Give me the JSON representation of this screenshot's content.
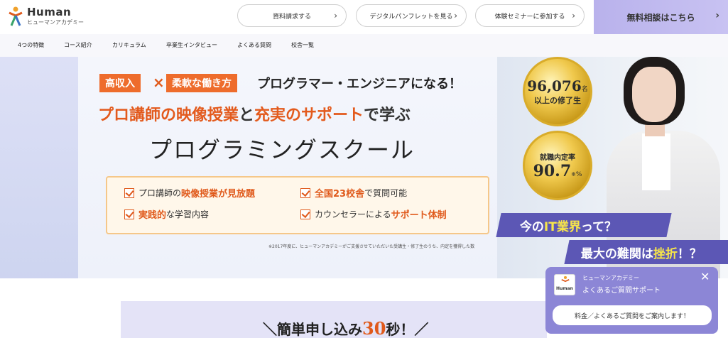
{
  "header": {
    "logo_word": "Human",
    "logo_sub": "ヒューマンアカデミー",
    "links": [
      {
        "label": "資料請求する"
      },
      {
        "label": "デジタルパンフレットを見る"
      },
      {
        "label": "体験セミナーに参加する"
      }
    ],
    "cta_label": "無料相談はこちら",
    "chevron": "›"
  },
  "nav": {
    "items": [
      "4つの特徴",
      "コース紹介",
      "カリキュラム",
      "卒業生インタビュー",
      "よくある質問",
      "校舎一覧"
    ]
  },
  "hero": {
    "tag1": "高収入",
    "times": "×",
    "tag2": "柔軟な働き方",
    "head1": "プログラマー・エンジニアになる！",
    "head2_part1": "プロ講師の映像授業",
    "head2_part2": "と",
    "head2_part3": "充実のサポート",
    "head2_part4": "で学ぶ",
    "head3": "プログラミングスクール",
    "features": [
      {
        "pre": "プロ講師の",
        "hl": "映像授業が見放題",
        "post": ""
      },
      {
        "pre": "",
        "hl": "全国23校舎",
        "post": "で質問可能"
      },
      {
        "pre": "",
        "hl": "実践的",
        "post": "な学習内容"
      },
      {
        "pre": "カウンセラーによる",
        "hl": "サポート体制",
        "post": ""
      }
    ],
    "footnote": "※2017年度に、ヒューマンアカデミーがご支援させていただいた受講生・修了生のうち、内定を獲得した数",
    "medal1": {
      "num": "96,076",
      "unit": "名",
      "sub": "以上の修了生"
    },
    "medal2": {
      "top": "就職内定率",
      "num": "90.7",
      "unit": "%",
      "mark": "※"
    },
    "banner1_pre": "今の",
    "banner1_hl": "IT業界",
    "banner1_post": "って？",
    "banner2_pre": "最大の難関は",
    "banner2_hl": "挫折",
    "banner2_post": "！？"
  },
  "apply": {
    "pre": "＼簡単申し込み",
    "num": "30",
    "post": "秒！／"
  },
  "chat": {
    "logo_word": "Human",
    "name": "ヒューマンアカデミー",
    "subtitle": "よくあるご質問サポート",
    "close": "✕",
    "bubble": "料金／よくあるご質問をご案内します！"
  },
  "colors": {
    "accent": "#e05a1c",
    "cta": "#c8c2f2",
    "banner": "#5c57b5",
    "gold": "#f0c94d"
  }
}
